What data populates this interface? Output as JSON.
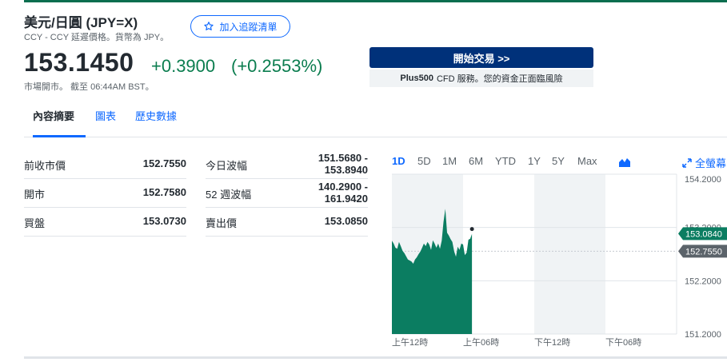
{
  "header": {
    "title": "美元/日圓 (JPY=X)",
    "subtitle": "CCY - CCY 延遲價格。貨幣為 JPY。",
    "watch_label": "加入追蹤清單"
  },
  "quote": {
    "price": "153.1450",
    "change": "+0.3900",
    "change_pct": "(+0.2553%)",
    "status": "市場開市。 截至 06:44AM BST。"
  },
  "promo": {
    "button": "開始交易 >>",
    "brand": "Plus500",
    "note": "CFD 服務。您的資金正面臨風險"
  },
  "tabs": [
    "內容摘要",
    "圖表",
    "歷史數據"
  ],
  "stats_left": [
    {
      "label": "前收市價",
      "value": "152.7550"
    },
    {
      "label": "開市",
      "value": "152.7580"
    },
    {
      "label": "買盤",
      "value": "153.0730"
    }
  ],
  "stats_right": [
    {
      "label": "今日波幅",
      "value1": "151.5680 -",
      "value2": "153.8940"
    },
    {
      "label": "52 週波幅",
      "value1": "140.2900 -",
      "value2": "161.9420"
    },
    {
      "label": "賣出價",
      "value1": "153.0850",
      "value2": ""
    }
  ],
  "chart_ranges": [
    "1D",
    "5D",
    "1M",
    "6M",
    "YTD",
    "1Y",
    "5Y",
    "Max"
  ],
  "fullscreen_label": "全螢幕",
  "colors": {
    "up": "#0b7d4f",
    "accent": "#0f69ff",
    "area": "#0b7d61"
  },
  "chart_data": {
    "type": "area",
    "x_ticks": [
      "上午12時",
      "上午06時",
      "下午12時",
      "下午06時"
    ],
    "y_ticks": [
      154.2,
      153.2,
      152.2,
      151.2
    ],
    "ylim": [
      151.2,
      154.2
    ],
    "current_label": "153.0840",
    "prev_close_label": "152.7550",
    "current": 153.084,
    "prev_close": 152.755,
    "x_domain_hours": [
      0,
      24
    ],
    "x": [
      0.0,
      0.15,
      0.3,
      0.45,
      0.6,
      0.75,
      0.9,
      1.05,
      1.2,
      1.35,
      1.5,
      1.65,
      1.8,
      1.95,
      2.1,
      2.25,
      2.4,
      2.55,
      2.7,
      2.85,
      3.0,
      3.15,
      3.3,
      3.45,
      3.6,
      3.75,
      3.9,
      4.05,
      4.2,
      4.35,
      4.5,
      4.65,
      4.8,
      4.95,
      5.1,
      5.25,
      5.4,
      5.55,
      5.7,
      5.85,
      6.0,
      6.15,
      6.3,
      6.45,
      6.6,
      6.75
    ],
    "y": [
      152.95,
      152.9,
      152.82,
      152.8,
      152.93,
      152.85,
      152.76,
      152.72,
      152.66,
      152.6,
      152.58,
      152.56,
      152.52,
      152.6,
      152.64,
      152.7,
      152.75,
      152.82,
      152.9,
      152.85,
      152.93,
      152.88,
      152.78,
      152.96,
      152.9,
      152.82,
      152.9,
      152.8,
      152.95,
      153.3,
      153.55,
      153.1,
      153.05,
      152.98,
      152.93,
      152.75,
      152.65,
      152.84,
      152.78,
      152.9,
      152.88,
      152.68,
      152.73,
      152.97,
      152.99,
      153.08
    ]
  }
}
